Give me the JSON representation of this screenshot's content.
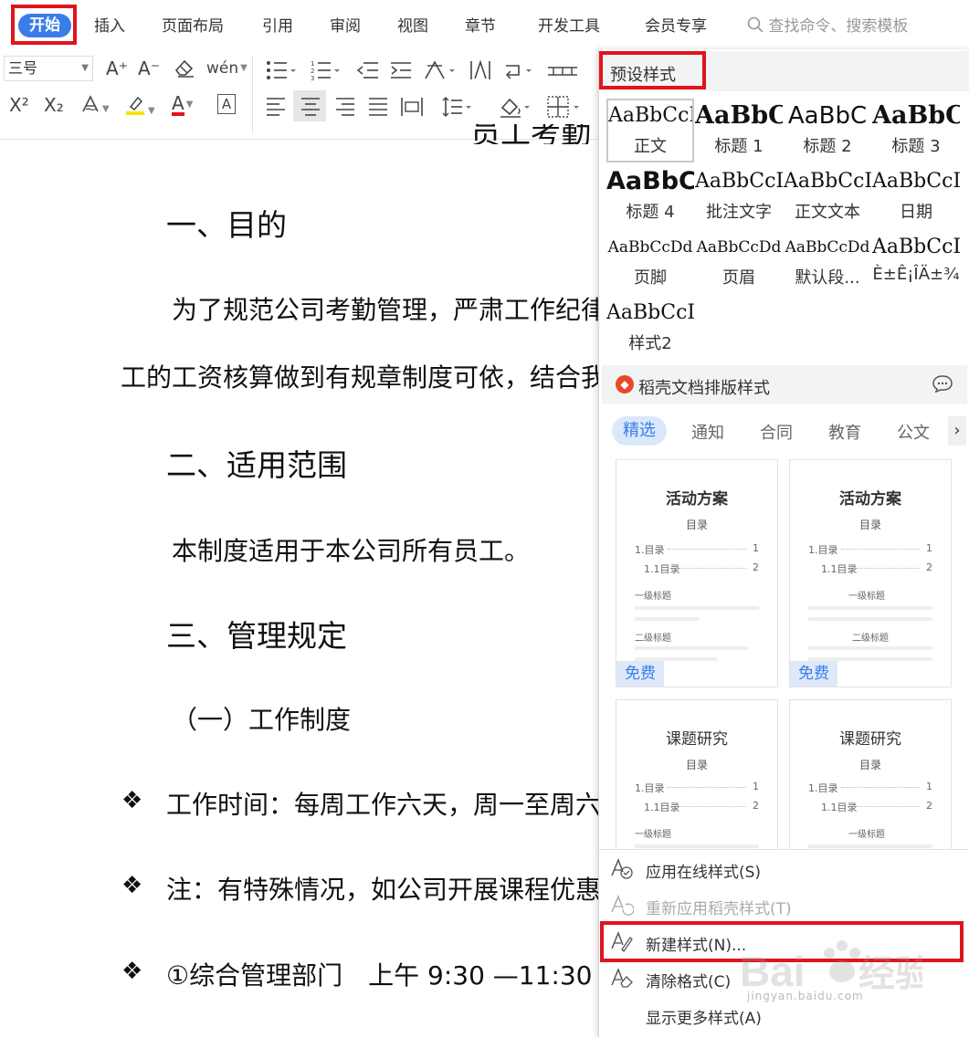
{
  "menubar": {
    "start": "开始",
    "items": [
      "插入",
      "页面布局",
      "引用",
      "审阅",
      "视图",
      "章节",
      "开发工具",
      "会员专享"
    ],
    "search_placeholder": "查找命令、搜索模板"
  },
  "toolbar": {
    "font_size": "三号",
    "grow_font": "A⁺",
    "shrink_font": "A⁻",
    "phonetic": "wén",
    "superscript": "X²",
    "subscript": "X₂",
    "font_color": "A",
    "char_border": "A"
  },
  "document": {
    "title_fragment": "员工考勤",
    "h1": "一、目的",
    "p1_line1": "为了规范公司考勤管理，严肃工作纪律",
    "p1_line2": "工的工资核算做到有规章制度可依，结合我",
    "h2": "二、适用范围",
    "p2": "本制度适用于本公司所有员工。",
    "h3": "三、管理规定",
    "sub1": "（一）工作制度",
    "bullet_symbol": "❖",
    "b1": "工作时间：每周工作六天，周一至周六",
    "b2": "注：有特殊情况，如公司开展课程优惠",
    "b3": "①综合管理部门　上午 9:30 —11:30"
  },
  "panel": {
    "header": "预设样式",
    "styles": [
      {
        "sample": "AaBbCcI",
        "name": "正文"
      },
      {
        "sample": "AaBbC",
        "name": "标题 1"
      },
      {
        "sample": "AaBbC",
        "name": "标题 2"
      },
      {
        "sample": "AaBbC",
        "name": "标题 3"
      },
      {
        "sample": "AaBbC",
        "name": "标题 4"
      },
      {
        "sample": "AaBbCcI",
        "name": "批注文字"
      },
      {
        "sample": "AaBbCcI",
        "name": "正文文本"
      },
      {
        "sample": "AaBbCcI",
        "name": "日期"
      },
      {
        "sample": "AaBbCcDd",
        "name": "页脚"
      },
      {
        "sample": "AaBbCcDd",
        "name": "页眉"
      },
      {
        "sample": "AaBbCcDd",
        "name": "默认段..."
      },
      {
        "sample": "AaBbCcI",
        "name": "È±Ê¡ÎÄ±¾"
      },
      {
        "sample": "AaBbCcI",
        "name": "样式2"
      }
    ],
    "daoke_title": "稻壳文档排版样式",
    "categories": [
      "精选",
      "通知",
      "合同",
      "教育",
      "公文"
    ],
    "templates": [
      {
        "title": "活动方案",
        "toc": "目录",
        "r1": "1.目录",
        "r1n": "1",
        "r2": "1.1目录",
        "r2n": "2",
        "l1": "一级标题",
        "l2": "二级标题",
        "badge": "免费"
      },
      {
        "title": "活动方案",
        "toc": "目录",
        "r1": "1.目录",
        "r1n": "1",
        "r2": "1.1目录",
        "r2n": "2",
        "l1": "一级标题",
        "l2": "二级标题",
        "badge": "免费"
      },
      {
        "title": "课题研究",
        "toc": "目录",
        "r1": "1.目录",
        "r1n": "1",
        "r2": "1.1目录",
        "r2n": "2",
        "l1": "一级标题"
      },
      {
        "title": "课题研究",
        "toc": "目录",
        "r1": "1.目录",
        "r1n": "1",
        "r2": "1.1目录",
        "r2n": "2",
        "l1": "一级标题"
      }
    ],
    "menu": {
      "apply_online": "应用在线样式(S)",
      "reapply": "重新应用稻壳样式(T)",
      "new_style": "新建样式(N)...",
      "clear": "清除格式(C)",
      "more": "显示更多样式(A)"
    }
  },
  "watermark": {
    "text": "jingyan.baidu.com"
  },
  "colors": {
    "accent": "#3a7de8",
    "highlight_box": "#e0141e"
  }
}
